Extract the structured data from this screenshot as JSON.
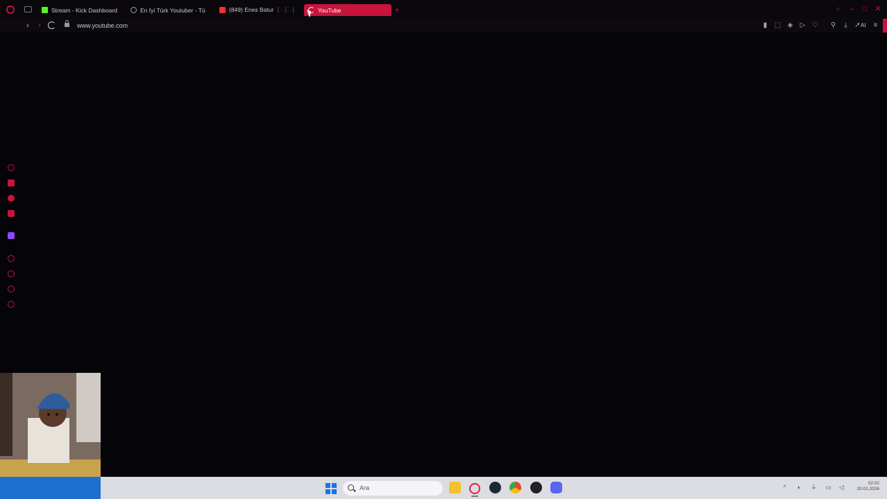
{
  "browser": {
    "tabs": [
      {
        "title": "Stream - Kick Dashboard",
        "favicon": "kick-icon",
        "active": false
      },
      {
        "title": "En İyi Türk Youtuber - Tü",
        "favicon": "globe-icon",
        "active": false
      },
      {
        "title": "(849) Enes Batur ⋮ ⋮ ⋮ ,",
        "favicon": "youtube-icon",
        "active": false
      },
      {
        "title": "YouTube",
        "favicon": "loading-icon",
        "active": true
      }
    ],
    "address": {
      "url": "www.youtube.com"
    },
    "toolbar": {
      "ai_label": "AI"
    },
    "accent_color": "#c8143c"
  },
  "sidebar": {
    "items": [
      "history-icon",
      "bell-icon",
      "messenger-icon",
      "wallet-icon",
      "twitch-icon",
      "player-icon",
      "clock-icon",
      "whatsapp-icon",
      "settings-icon"
    ]
  },
  "taskbar": {
    "search_placeholder": "Ara",
    "apps": [
      "file-explorer-icon",
      "opera-gx-icon",
      "steam-icon",
      "chrome-icon",
      "obs-icon",
      "discord-icon"
    ],
    "clock_time": "02:02",
    "clock_date": "20.01.2026"
  }
}
